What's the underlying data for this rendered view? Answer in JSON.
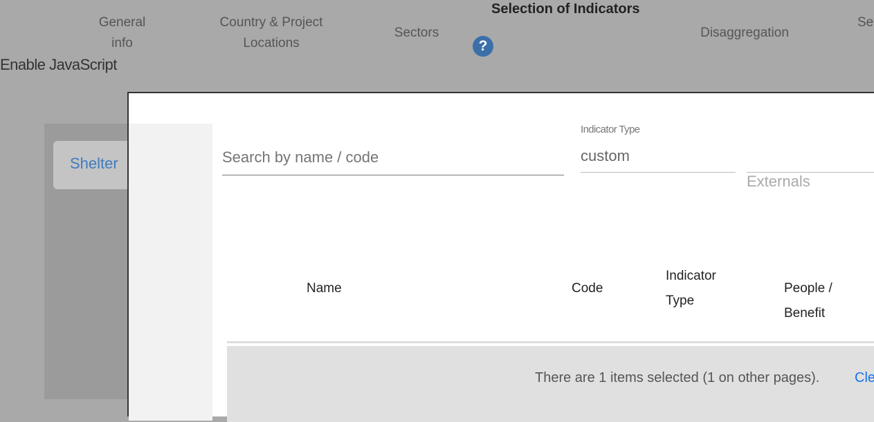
{
  "nav": {
    "steps": [
      {
        "label": "General\ninfo"
      },
      {
        "label": "Country & Project\nLocations"
      },
      {
        "label": "Sectors"
      },
      {
        "label": "Selection of Indicators"
      },
      {
        "label": "Disaggregation"
      },
      {
        "label": "Se"
      }
    ],
    "help_glyph": "?"
  },
  "noscript_text": "Enable JavaScript",
  "sidebar": {
    "items": [
      {
        "label": "Shelter"
      }
    ]
  },
  "modal": {
    "search": {
      "value": "",
      "placeholder": "Search by name / code"
    },
    "indicator_type": {
      "label": "Indicator Type",
      "value": "custom"
    },
    "externals_label": "Externals",
    "table": {
      "columns": [
        "Name",
        "Code",
        "Indicator Type",
        "People / Benefit"
      ]
    },
    "selection": {
      "text": "There are 1 items selected (1 on other pages).",
      "clear_label": "Cle"
    }
  }
}
